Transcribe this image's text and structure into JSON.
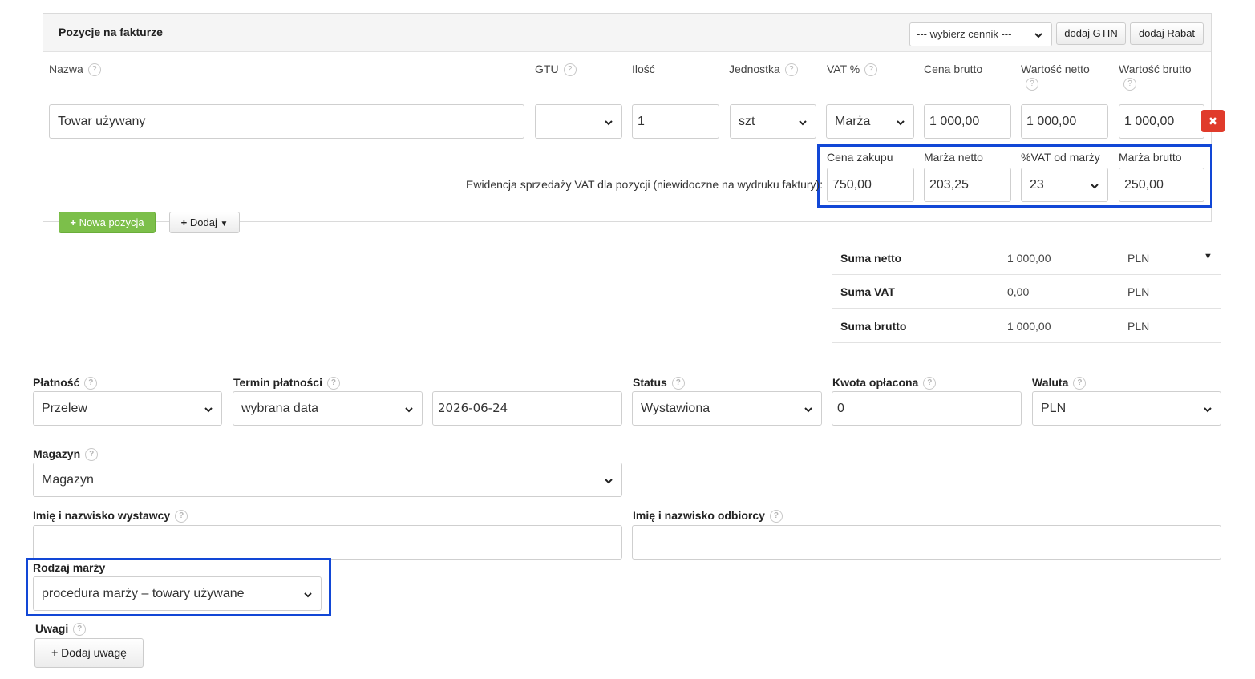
{
  "items_section": {
    "title": "Pozycje na fakturze",
    "pricelist_select": "--- wybierz cennik ---",
    "add_gtin": "dodaj GTIN",
    "add_discount": "dodaj Rabat",
    "columns": {
      "name": "Nazwa",
      "gtu": "GTU",
      "qty": "Ilość",
      "unit": "Jednostka",
      "vat": "VAT %",
      "gross_price": "Cena brutto",
      "net_value": "Wartość netto",
      "gross_value": "Wartość brutto"
    },
    "row": {
      "name": "Towar używany",
      "gtu": "",
      "qty": "1",
      "unit": "szt",
      "vat": "Marża",
      "gross_price": "1 000,00",
      "net_value": "1 000,00",
      "gross_value": "1 000,00"
    },
    "margin": {
      "note": "Ewidencja sprzedaży VAT dla pozycji (niewidoczne na wydruku faktury):",
      "purchase_price_label": "Cena zakupu",
      "purchase_price": "750,00",
      "net_margin_label": "Marża netto",
      "net_margin": "203,25",
      "vat_rate_label": "%VAT od marży",
      "vat_rate": "23",
      "gross_margin_label": "Marża brutto",
      "gross_margin": "250,00"
    },
    "new_item": "Nowa pozycja",
    "add": "Dodaj"
  },
  "totals": [
    {
      "label": "Suma netto",
      "value": "1 000,00",
      "currency": "PLN"
    },
    {
      "label": "Suma VAT",
      "value": "0,00",
      "currency": "PLN"
    },
    {
      "label": "Suma brutto",
      "value": "1 000,00",
      "currency": "PLN"
    }
  ],
  "form": {
    "payment_label": "Płatność",
    "payment": "Przelew",
    "due_label": "Termin płatności",
    "due_type": "wybrana data",
    "due_date": "2026-06-24",
    "status_label": "Status",
    "status": "Wystawiona",
    "paid_label": "Kwota opłacona",
    "paid": "0",
    "currency_label": "Waluta",
    "currency": "PLN",
    "warehouse_label": "Magazyn",
    "warehouse": "Magazyn",
    "issuer_label": "Imię i nazwisko wystawcy",
    "issuer": "",
    "recipient_label": "Imię i nazwisko odbiorcy",
    "recipient": "",
    "margin_type_label": "Rodzaj marży",
    "margin_type": "procedura marży – towary używane",
    "notes_label": "Uwagi",
    "add_note": "Dodaj uwagę"
  },
  "icons": {
    "help": "?",
    "delete": "✖",
    "plus": "+"
  },
  "colors": {
    "highlight": "#1247d6",
    "delete": "#e03b2b",
    "new_item": "#7cbf4a"
  }
}
